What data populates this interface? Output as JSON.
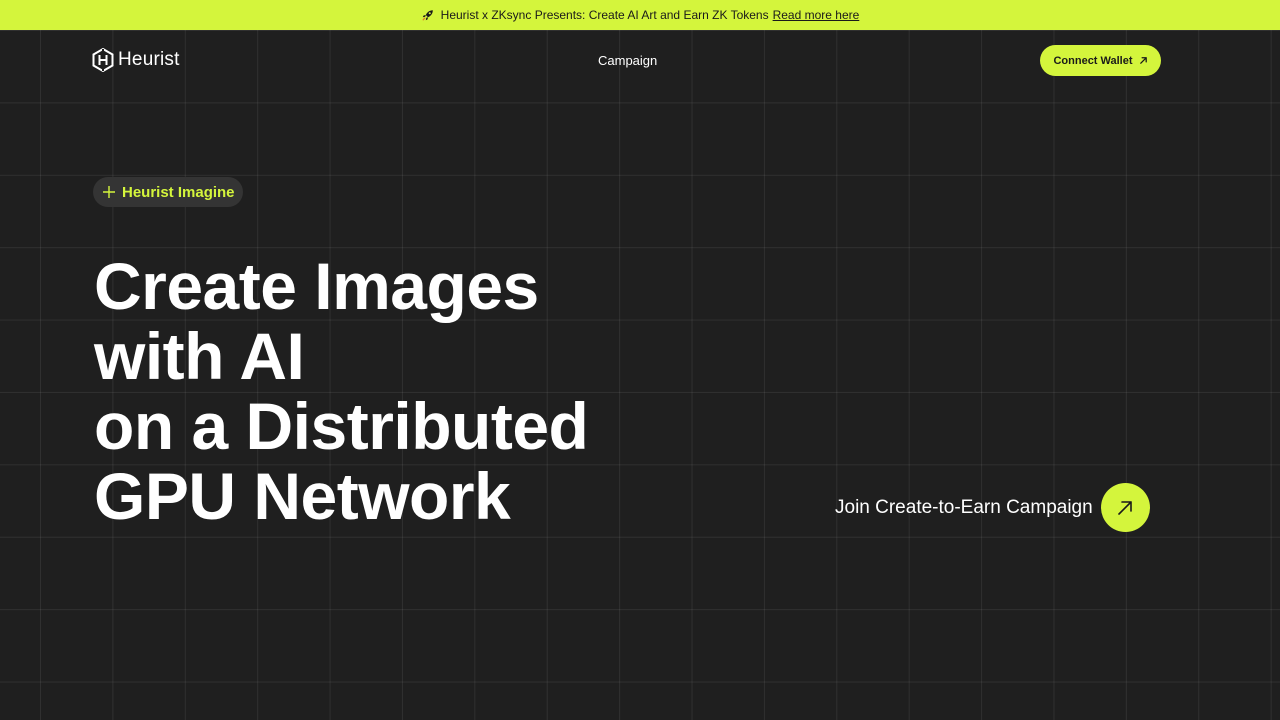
{
  "banner": {
    "icon": "rocket-icon",
    "text": "Heurist x ZKsync Presents: Create AI Art and Earn ZK Tokens",
    "link_label": "Read more here",
    "background_color": "#d4f53c"
  },
  "header": {
    "logo_text": "Heurist",
    "logo_icon": "heurist-logo-icon",
    "nav": {
      "campaign_label": "Campaign"
    },
    "connect_wallet_label": "Connect Wallet",
    "connect_wallet_icon": "arrow-up-right-icon"
  },
  "badge": {
    "icon": "plus-icon",
    "label": "Heurist Imagine"
  },
  "hero": {
    "title_lines": [
      "Create Images",
      "with AI",
      "on a Distributed",
      "GPU Network"
    ]
  },
  "cta": {
    "label": "Join Create-to-Earn Campaign",
    "icon": "arrow-up-right-icon"
  },
  "colors": {
    "accent": "#d4f53c",
    "background": "#1f1f1f",
    "badge_background": "#343434",
    "text": "#ffffff"
  }
}
